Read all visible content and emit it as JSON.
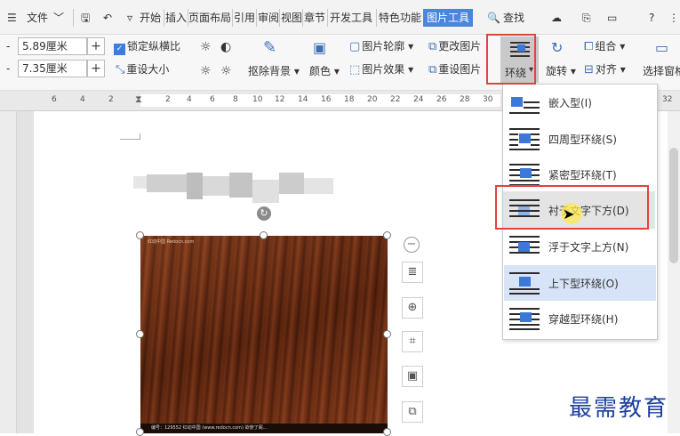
{
  "menubar": {
    "file_label": "文件",
    "tabs": [
      "开始",
      "插入",
      "页面布局",
      "引用",
      "审阅",
      "视图",
      "章节",
      "开发工具",
      "特色功能",
      "图片工具"
    ],
    "search_label": "查找"
  },
  "ribbon": {
    "height_value": "5.89厘米",
    "width_value": "7.35厘米",
    "lock_ratio_label": "锁定纵横比",
    "reset_size_label": "重设大小",
    "remove_bg_label": "抠除背景",
    "color_label": "颜色",
    "outline_label": "图片轮廓",
    "effects_label": "图片效果",
    "change_pic_label": "更改图片",
    "reset_pic_label": "重设图片",
    "wrap_label": "环绕",
    "rotate_label": "旋转",
    "group_label": "组合",
    "align_label": "对齐",
    "select_pane_label": "选择窗格"
  },
  "ruler": {
    "ticks": [
      "6",
      "4",
      "2",
      "2",
      "4",
      "6",
      "8",
      "10",
      "12",
      "14",
      "16",
      "18",
      "20",
      "22",
      "24",
      "26",
      "28",
      "30",
      "32"
    ]
  },
  "wrap_menu": {
    "items": [
      {
        "label": "嵌入型(I)"
      },
      {
        "label": "四周型环绕(S)"
      },
      {
        "label": "紧密型环绕(T)"
      },
      {
        "label": "衬于文字下方(D)"
      },
      {
        "label": "浮于文字上方(N)"
      },
      {
        "label": "上下型环绕(O)"
      },
      {
        "label": "穿越型环绕(H)"
      }
    ],
    "highlighted_index": 3
  },
  "image": {
    "header_text": "红动中国 Redocn.com",
    "footer_text": "编号：129552  红动中国 (www.redocn.com)  欲使了阁..."
  },
  "watermark": "最需教育",
  "colors": {
    "accent": "#4b86de",
    "highlight_box": "#e0443b",
    "watermark": "#1f3f9e"
  }
}
